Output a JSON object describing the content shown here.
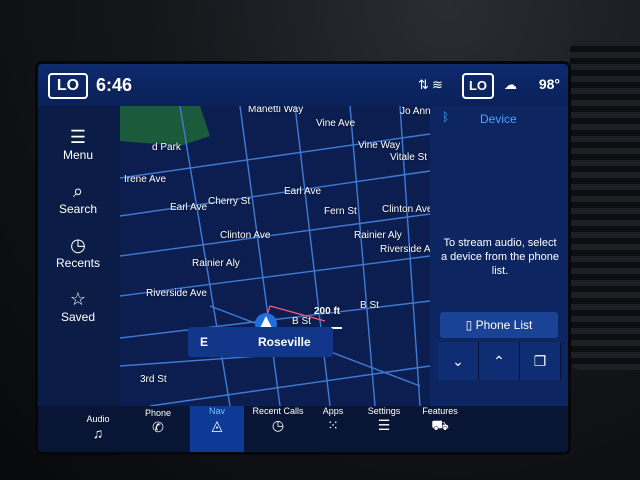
{
  "status_bar": {
    "left_climate_label": "LO",
    "time": "6:46",
    "right_climate_label": "LO",
    "temperature": "98°",
    "icons": [
      "signal-icon",
      "wifi-icon",
      "weather-icon"
    ]
  },
  "left_menu": {
    "items": [
      {
        "label": "Menu",
        "icon": "hamburger-icon"
      },
      {
        "label": "Search",
        "icon": "search-icon"
      },
      {
        "label": "Recents",
        "icon": "clock-icon"
      },
      {
        "label": "Saved",
        "icon": "star-icon"
      }
    ]
  },
  "map": {
    "park_label": "d Park",
    "streets": [
      "Manetti Way",
      "Jo Anne L",
      "Vine Ave",
      "Vine Way",
      "Vitale St",
      "Irene Ave",
      "Earl Ave",
      "Cherry St",
      "Earl Ave",
      "Fern St",
      "Clinton Ave",
      "Clinton Ave",
      "Rainier Aly",
      "Rainier Aly",
      "Riverside Ave",
      "Riverside Ave",
      "B St",
      "B St",
      "3rd St"
    ],
    "scale_label": "200 ft",
    "destination_direction": "E",
    "destination_name": "Roseville"
  },
  "right_panel": {
    "title": "Device",
    "message": "To stream audio, select a device from the phone list.",
    "phone_list_label": "Phone List",
    "controls": [
      "chevron-down-icon",
      "chevron-up-icon",
      "copy-icon"
    ]
  },
  "dock": {
    "items": [
      {
        "label": "Audio",
        "icon": "music-icon"
      },
      {
        "label": "Phone",
        "icon": "phone-icon"
      },
      {
        "label": "Nav",
        "icon": "navigation-icon",
        "active": true
      },
      {
        "label": "Recent Calls",
        "icon": "clock-icon"
      },
      {
        "label": "Apps",
        "icon": "apps-grid-icon"
      },
      {
        "label": "Settings",
        "icon": "sliders-icon"
      },
      {
        "label": "Features",
        "icon": "car-icon"
      }
    ]
  },
  "colors": {
    "accent": "#2f8cff",
    "panel": "#0d2560",
    "map_bg": "#0c1e4f"
  }
}
